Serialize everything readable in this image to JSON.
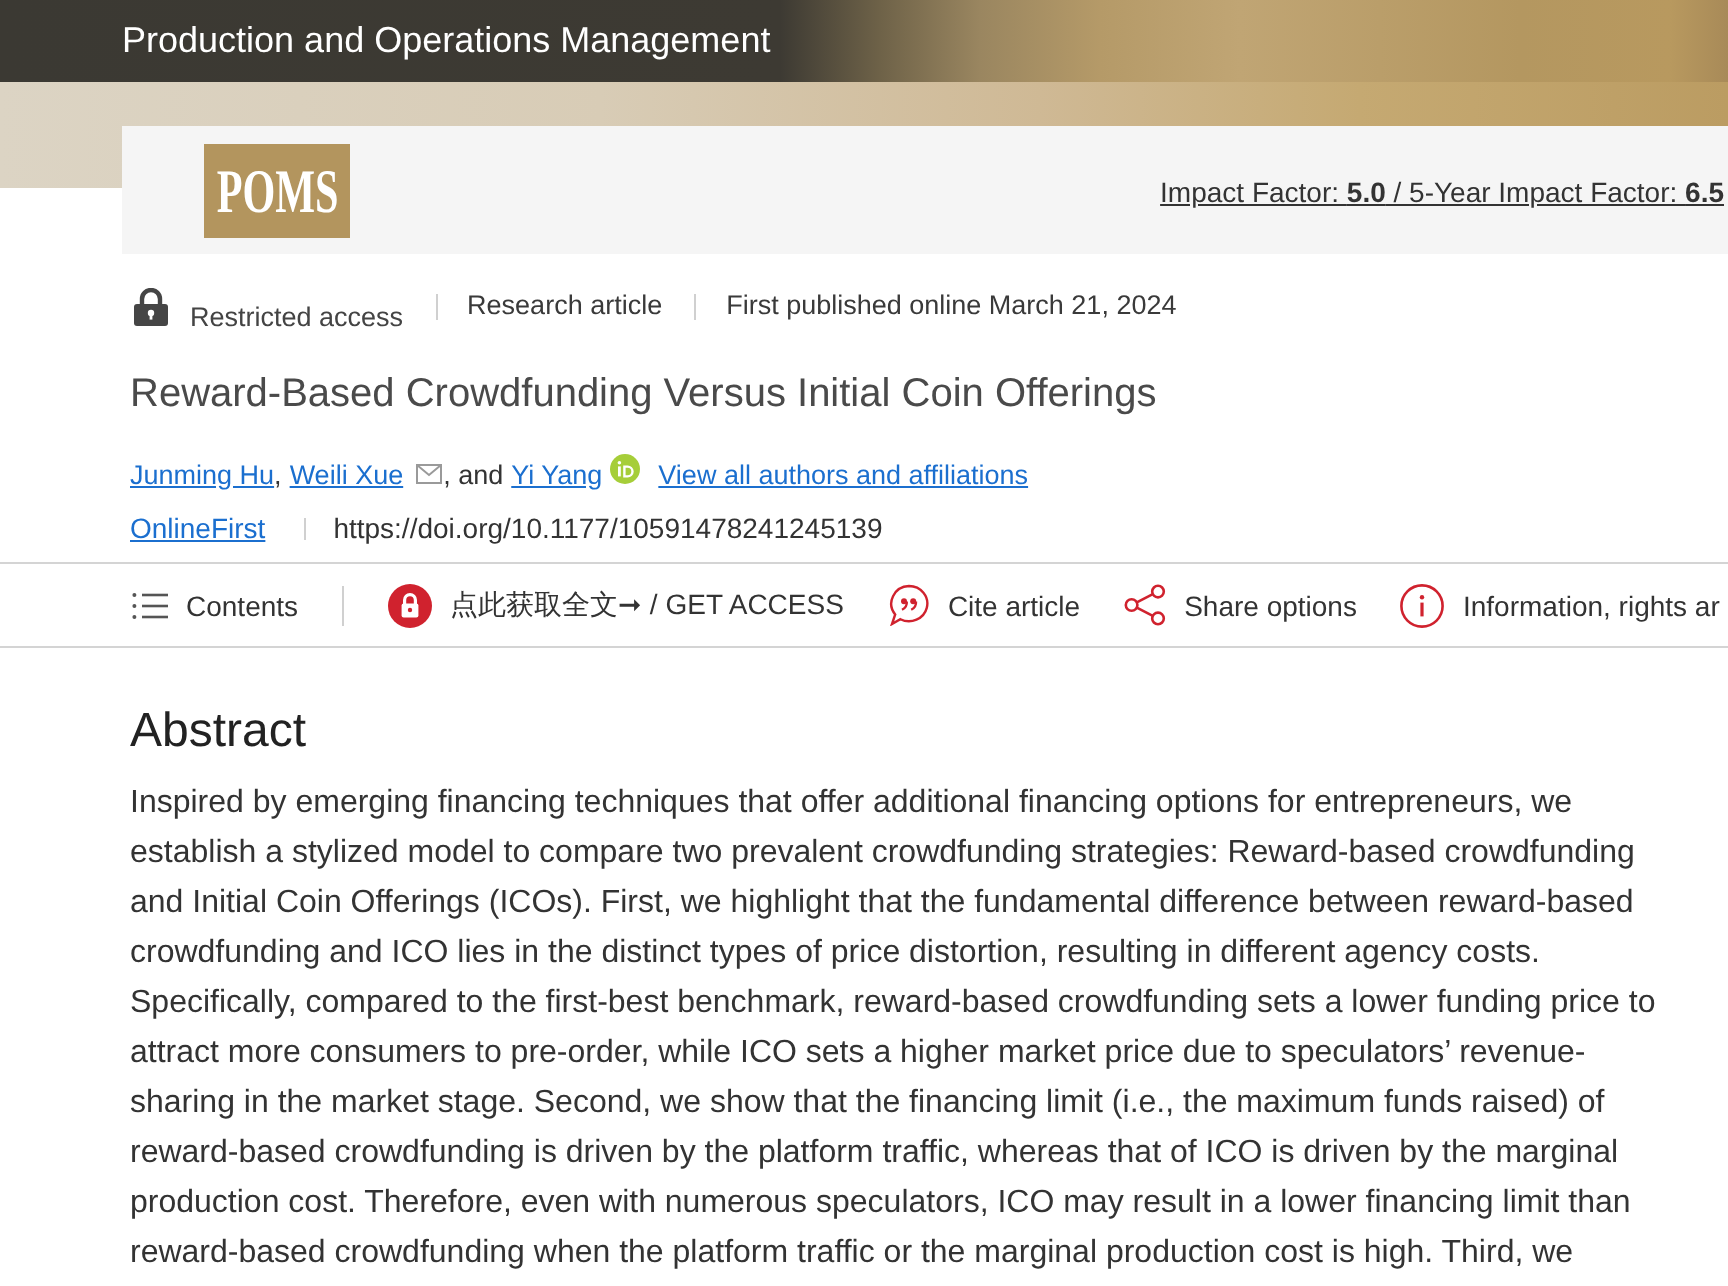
{
  "header": {
    "title": "Production and Operations Management"
  },
  "journal_card": {
    "logo": "POMS",
    "metrics": "Impact Factor: **5.0** / 5-Year Impact Factor: **6.5**"
  },
  "article": {
    "access": "Restricted access",
    "type": "Research article",
    "published": "First published online March 21, 2024",
    "title": "Reward-Based Crowdfunding Versus Initial Coin Offerings",
    "authors": [
      {
        "name": "Junming Hu",
        "after": ","
      },
      {
        "name": "Weili Xue",
        "email": true,
        "after": ", and"
      },
      {
        "name": "Yi Yang",
        "orcid": true
      }
    ],
    "all_authors_link": "View all authors and affiliations",
    "status": "OnlineFirst",
    "doi": "https://doi.org/10.1177/10591478241245139"
  },
  "toolbar": [
    {
      "kind": "contents",
      "label": "Contents"
    },
    {
      "kind": "access",
      "label": "点此获取全文➞ / GET ACCESS"
    },
    {
      "kind": "cite",
      "label": "Cite article"
    },
    {
      "kind": "share",
      "label": "Share options"
    },
    {
      "kind": "info",
      "label": "Information, rights ar"
    }
  ],
  "abstract": {
    "heading": "Abstract",
    "text": "Inspired by emerging financing techniques that offer additional financing options for entrepreneurs, we establish a stylized model to compare two prevalent crowdfunding strategies: Reward-based crowdfunding and Initial Coin Offerings (ICOs). First, we highlight that the fundamental difference between reward-based crowdfunding and ICO lies in the distinct types of price distortion, resulting in different agency costs. Specifically, compared to the first-best benchmark, reward-based crowdfunding sets a lower funding price to attract more consumers to pre-order, while ICO sets a higher market price due to speculators’ revenue-sharing in the market stage. Second, we show that the financing limit (i.e., the maximum funds raised) of reward-based crowdfunding is driven by the platform traffic, whereas that of ICO is driven by the marginal production cost. Therefore, even with numerous speculators, ICO may result in a lower financing limit than reward-based crowdfunding when the platform traffic or the marginal production cost is high. Third, we"
  }
}
